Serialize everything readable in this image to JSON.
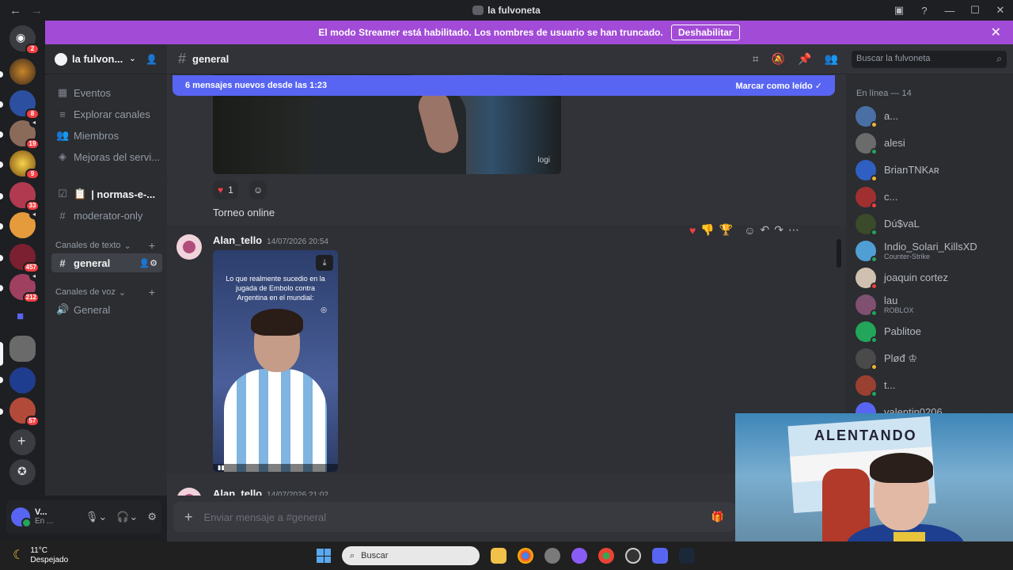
{
  "window": {
    "title": "la fulvoneta"
  },
  "streamer_banner": {
    "text": "El modo Streamer está habilitado. Los nombres de usuario se han truncado.",
    "button": "Deshabilitar"
  },
  "servers": [
    {
      "color": "#f23f42",
      "badge": "2"
    },
    {
      "color": "#6b4a2e",
      "badge": ""
    },
    {
      "color": "#2c4fa0",
      "badge": "8"
    },
    {
      "color": "#8a6b5a",
      "badge": "19"
    },
    {
      "color": "#d8a620",
      "badge": "9"
    },
    {
      "color": "#b23a50",
      "badge": "33"
    },
    {
      "color": "#e59a3c",
      "badge": ""
    },
    {
      "color": "#7a2030",
      "badge": "457"
    },
    {
      "color": "#a04060",
      "badge": "212"
    },
    {
      "color": "#5865f2",
      "badge": ""
    },
    {
      "color": "#6a6a6a",
      "badge": ""
    },
    {
      "color": "#1f3d8f",
      "badge": ""
    },
    {
      "color": "#b24a3a",
      "badge": "57"
    }
  ],
  "guild": {
    "name": "la fulvon..."
  },
  "sidebar": {
    "events": "Eventos",
    "browse": "Explorar canales",
    "members": "Miembros",
    "boosts": "Mejoras del servi...",
    "rules": "| normas-e-...",
    "mod": "moderator-only",
    "text_category": "Canales de texto",
    "general_text": "general",
    "voice_category": "Canales de voz",
    "general_voice": "General"
  },
  "user": {
    "name": "V...",
    "status": "En ..."
  },
  "channel_header": {
    "name": "general",
    "search_placeholder": "Buscar la fulvoneta"
  },
  "new_messages": {
    "text": "6 mensajes nuevos desde las 1:23",
    "mark_read": "Marcar como leído"
  },
  "messages": [
    {
      "reaction_count": "1",
      "text": "Torneo online"
    },
    {
      "author": "Alan_tello",
      "time": "14/07/2026 20:54",
      "video_caption": "Lo que realmente sucedio en la jugada de Embolo contra Argentina en el mundial:"
    },
    {
      "author": "Alan_tello",
      "time": "14/07/2026 21:02"
    }
  ],
  "composer": {
    "placeholder": "Enviar mensaje a #general"
  },
  "members": {
    "header": "En línea — 14",
    "list": [
      {
        "name": "a...",
        "activity": "",
        "color": "#4a6fa5",
        "status": "#f0b232"
      },
      {
        "name": "alesi",
        "activity": "",
        "color": "#6b6b6b",
        "status": "#23a55a"
      },
      {
        "name": "BrianTNKᴀʀ",
        "activity": "",
        "color": "#2f5fc2",
        "status": "#f0b232"
      },
      {
        "name": "c...",
        "activity": "",
        "color": "#a03030",
        "status": "#f23f42"
      },
      {
        "name": "Dú$vaL",
        "activity": "",
        "color": "#3a4a2a",
        "status": "#23a55a"
      },
      {
        "name": "Indio_Solari_KillsXD",
        "activity": "Counter-Strike",
        "color": "#4f9fd4",
        "status": "#23a55a"
      },
      {
        "name": "joaquin cortez",
        "activity": "",
        "color": "#d0c0b0",
        "status": "#f23f42"
      },
      {
        "name": "lau",
        "activity": "ROBLOX",
        "color": "#805070",
        "status": "#23a55a"
      },
      {
        "name": "Pablitoe",
        "activity": "",
        "color": "#23a55a",
        "status": "#23a55a"
      },
      {
        "name": "Pløđ ♔",
        "activity": "",
        "color": "#4a4a4a",
        "status": "#f0b232"
      },
      {
        "name": "t...",
        "activity": "",
        "color": "#9a4030",
        "status": "#23a55a"
      },
      {
        "name": "valentin0206",
        "activity": "",
        "color": "#5865f2",
        "status": "#23a55a"
      }
    ]
  },
  "taskbar": {
    "temp": "11°C",
    "weather": "Despejado",
    "search": "Buscar"
  }
}
